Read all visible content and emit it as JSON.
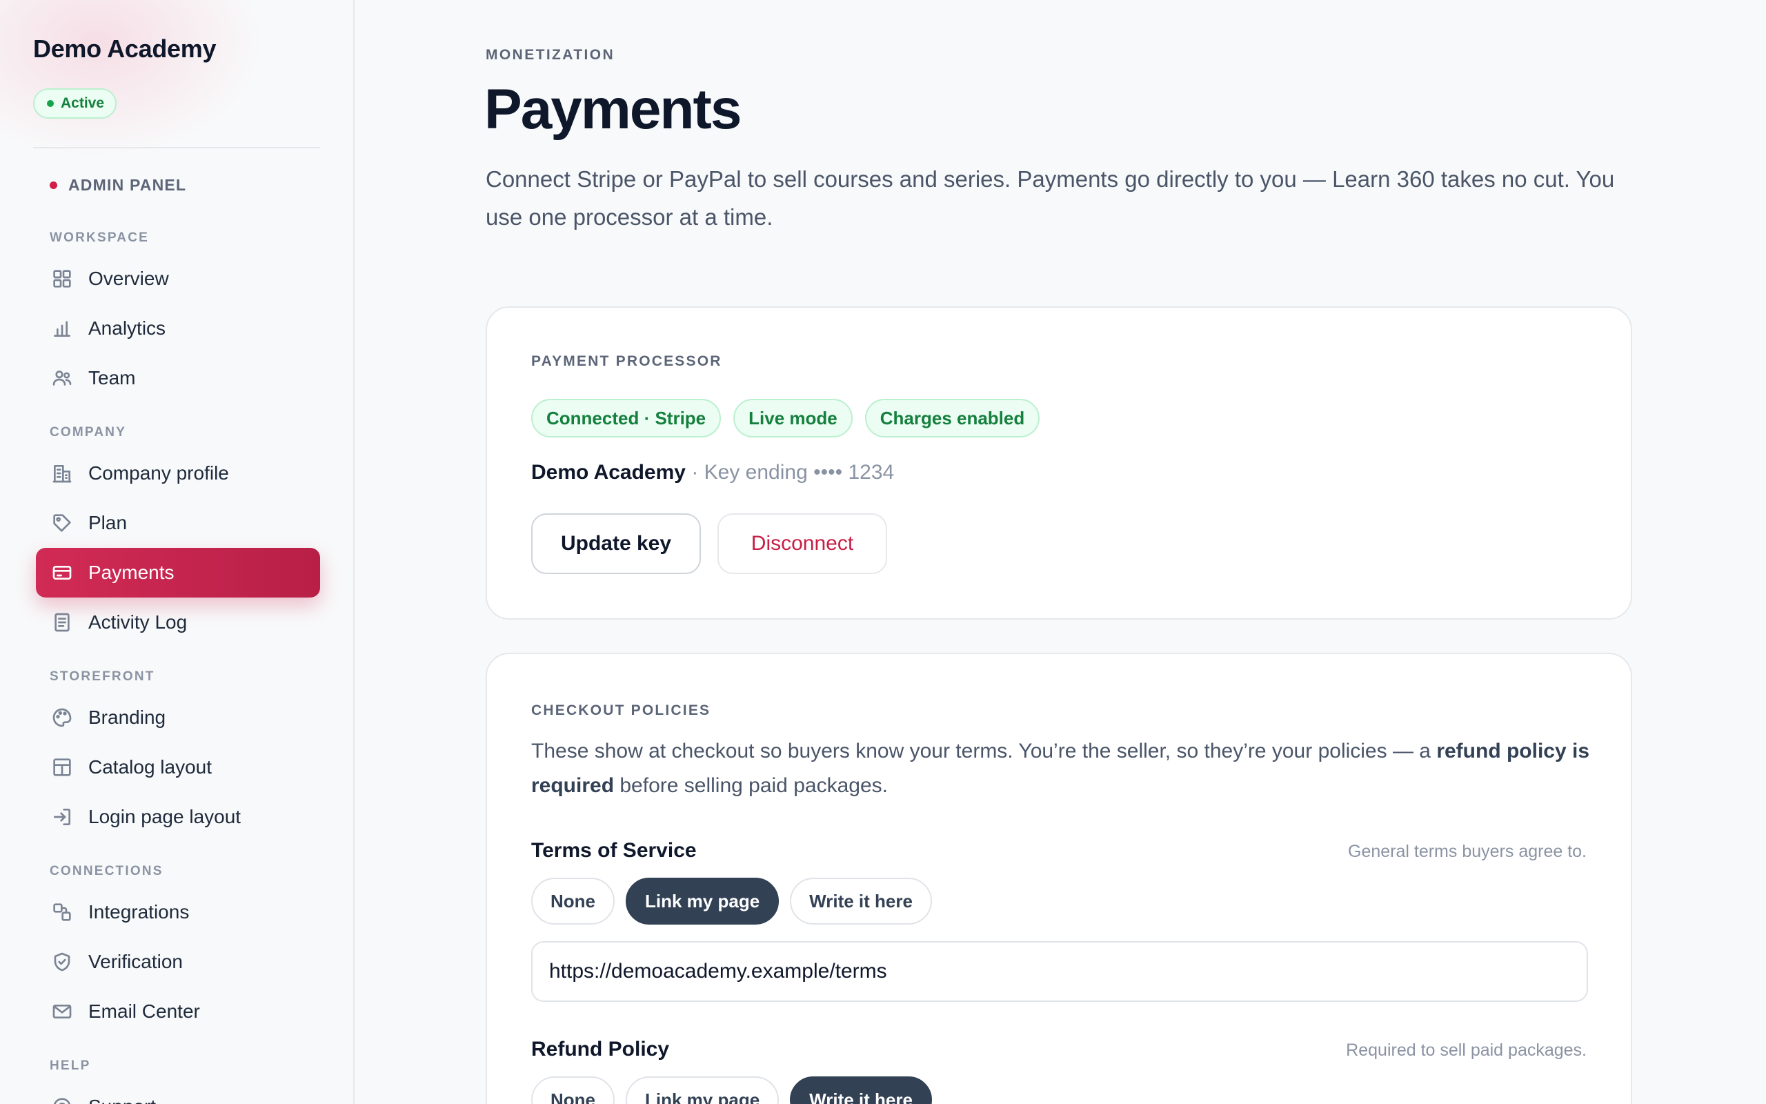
{
  "sidebar": {
    "brand": "Demo Academy",
    "status": "Active",
    "panel_label": "ADMIN PANEL",
    "sections": {
      "workspace": "WORKSPACE",
      "company": "COMPANY",
      "storefront": "STOREFRONT",
      "connections": "CONNECTIONS",
      "help": "HELP"
    },
    "items": [
      {
        "label": "Overview",
        "icon": "grid-icon"
      },
      {
        "label": "Analytics",
        "icon": "bar-chart-icon"
      },
      {
        "label": "Team",
        "icon": "users-icon"
      },
      {
        "label": "Company profile",
        "icon": "building-icon"
      },
      {
        "label": "Plan",
        "icon": "tag-icon"
      },
      {
        "label": "Payments",
        "icon": "credit-card-icon",
        "active": true
      },
      {
        "label": "Activity Log",
        "icon": "document-icon"
      },
      {
        "label": "Branding",
        "icon": "palette-icon"
      },
      {
        "label": "Catalog layout",
        "icon": "layout-icon"
      },
      {
        "label": "Login page layout",
        "icon": "login-icon"
      },
      {
        "label": "Integrations",
        "icon": "integrations-icon"
      },
      {
        "label": "Verification",
        "icon": "shield-check-icon"
      },
      {
        "label": "Email Center",
        "icon": "mail-icon"
      },
      {
        "label": "Support",
        "icon": "support-icon"
      }
    ]
  },
  "header": {
    "eyebrow": "MONETIZATION",
    "title": "Payments",
    "description": "Connect Stripe or PayPal to sell courses and series. Payments go directly to you — Learn 360 takes no cut. You use one processor at a time."
  },
  "processor": {
    "heading": "PAYMENT PROCESSOR",
    "badges": [
      "Connected · Stripe",
      "Live mode",
      "Charges enabled"
    ],
    "account_name": "Demo Academy",
    "key_text": " · Key ending •••• 1234",
    "update_button": "Update key",
    "disconnect_button": "Disconnect"
  },
  "policies": {
    "heading": "CHECKOUT POLICIES",
    "desc_before": "These show at checkout so buyers know your terms. You’re the seller, so they’re your policies — a ",
    "desc_bold": "refund policy is required",
    "desc_after": " before selling paid packages.",
    "terms": {
      "label": "Terms of Service",
      "hint": "General terms buyers agree to.",
      "options": [
        "None",
        "Link my page",
        "Write it here"
      ],
      "selected": "Link my page",
      "url_value": "https://demoacademy.example/terms"
    },
    "refund": {
      "label": "Refund Policy",
      "hint": "Required to sell paid packages.",
      "options": [
        "None",
        "Link my page",
        "Write it here"
      ],
      "selected": "Write it here"
    }
  },
  "colors": {
    "accent": "#c8244e",
    "success": "#15803d",
    "selected_segment": "#334155"
  }
}
